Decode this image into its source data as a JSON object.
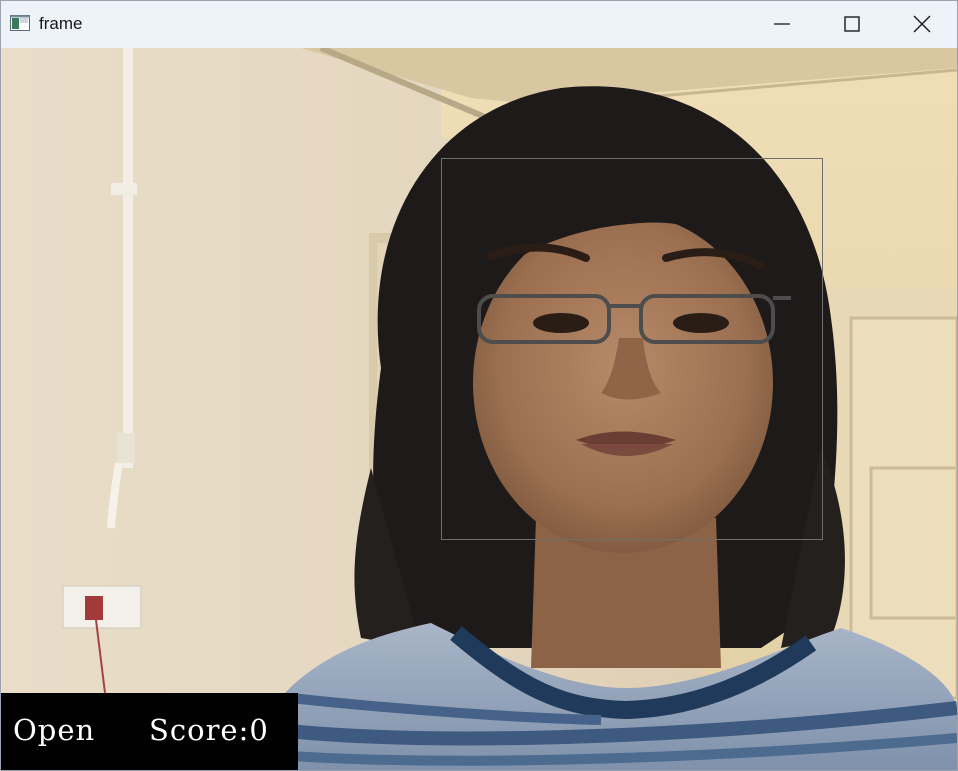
{
  "window": {
    "title": "frame",
    "icon": "app-window-icon",
    "controls": [
      "minimize-icon",
      "maximize-icon",
      "close-icon"
    ]
  },
  "video": {
    "content": "webcam frame with face detection rectangle",
    "face_box_color": "#6f6f6f"
  },
  "overlay": {
    "status": "Open",
    "score": "Score:0",
    "background": "#000000",
    "text_color": "#ffffff"
  }
}
